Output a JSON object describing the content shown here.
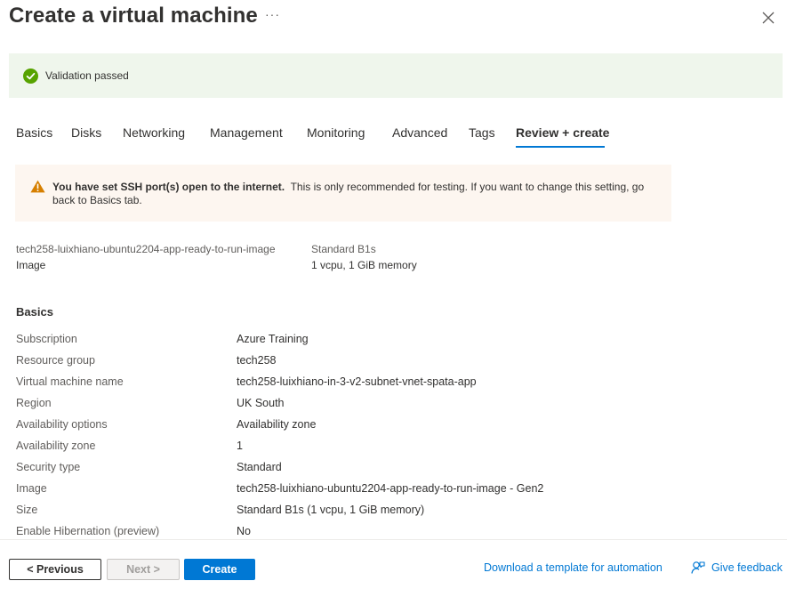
{
  "header": {
    "title": "Create a virtual machine",
    "more": "···"
  },
  "validation": {
    "text": "Validation passed",
    "color": "#57a300"
  },
  "tabs": [
    {
      "label": "Basics"
    },
    {
      "label": "Disks"
    },
    {
      "label": "Networking"
    },
    {
      "label": "Management"
    },
    {
      "label": "Monitoring"
    },
    {
      "label": "Advanced"
    },
    {
      "label": "Tags"
    },
    {
      "label": "Review + create",
      "active": true
    }
  ],
  "warning": {
    "bold": "You have set SSH port(s) open to the internet.",
    "text": "This is only recommended for testing.  If you want to change this setting, go back to Basics tab."
  },
  "summary": {
    "image_name": "tech258-luixhiano-ubuntu2204-app-ready-to-run-image",
    "image_label": "Image",
    "size_name": "Standard B1s",
    "size_spec": "1 vcpu, 1 GiB memory"
  },
  "basics": {
    "title": "Basics",
    "rows": [
      {
        "key": "Subscription",
        "value": "Azure Training"
      },
      {
        "key": "Resource group",
        "value": "tech258"
      },
      {
        "key": "Virtual machine name",
        "value": "tech258-luixhiano-in-3-v2-subnet-vnet-spata-app"
      },
      {
        "key": "Region",
        "value": "UK South"
      },
      {
        "key": "Availability options",
        "value": "Availability zone"
      },
      {
        "key": "Availability zone",
        "value": "1"
      },
      {
        "key": "Security type",
        "value": "Standard"
      },
      {
        "key": "Image",
        "value": "tech258-luixhiano-ubuntu2204-app-ready-to-run-image - Gen2"
      },
      {
        "key": "Size",
        "value": "Standard B1s (1 vcpu, 1 GiB memory)"
      },
      {
        "key": "Enable Hibernation (preview)",
        "value": "No"
      }
    ]
  },
  "footer": {
    "previous": "< Previous",
    "next": "Next >",
    "create": "Create",
    "download_link": "Download a template for automation",
    "feedback": "Give feedback"
  },
  "colors": {
    "accent": "#0078d4",
    "success": "#57a300",
    "warning": "#d67f00"
  }
}
